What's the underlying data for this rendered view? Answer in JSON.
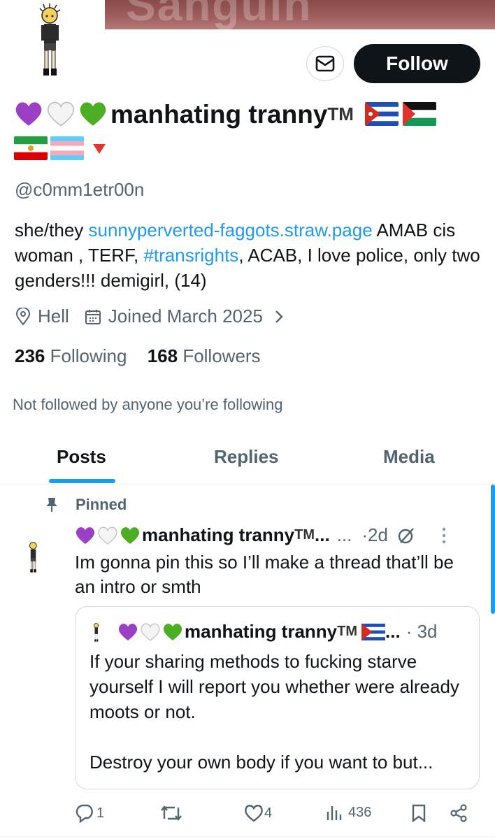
{
  "banner": {
    "partial_text": "Sanguin"
  },
  "header": {
    "follow_label": "Follow",
    "display_name": "manhating tranny",
    "name_tm": "TM",
    "handle": "@c0mm1etr00n",
    "flags": [
      "cuba-flag",
      "palestine-flag",
      "iran-lion-flag",
      "trans-flag",
      "red-triangle"
    ]
  },
  "bio": {
    "part1": "she/they ",
    "link": "sunnyperverted-faggots.straw.page",
    "part2": " AMAB cis woman , TERF, ",
    "hashtag": "#transrights",
    "part3": ", ACAB, I love police, only two genders!!! demigirl, (14)"
  },
  "meta": {
    "location": "Hell",
    "joined": "Joined March 2025"
  },
  "counts": {
    "following_count": "236",
    "following_label": "Following",
    "followers_count": "168",
    "followers_label": "Followers"
  },
  "not_followed_text": "Not followed by anyone you’re following",
  "tabs": [
    {
      "label": "Posts"
    },
    {
      "label": "Replies"
    },
    {
      "label": "Media"
    }
  ],
  "post": {
    "pinned_label": "Pinned",
    "name": "manhating tranny",
    "tm": "TM",
    "ellipsis": "...",
    "more": "...",
    "time": "·2d",
    "text": "Im gonna pin this so I’ll make a thread that’ll be an intro or smth",
    "quote": {
      "name": "manhating tranny",
      "tm": "TM",
      "ellipsis": "...",
      "time": "· 3d",
      "text_line1": "If your sharing methods to fucking starve yourself I will report you whether were already moots or not.",
      "text_line2": "Destroy your own body if you want to but..."
    },
    "actions": {
      "replies": "1",
      "reposts": "",
      "likes": "4",
      "views": "436"
    }
  },
  "colors": {
    "accent": "#1d9bf0",
    "text": "#0f1419",
    "muted": "#536471",
    "purple_heart": "#9b3fc4",
    "green_heart": "#4caf23"
  }
}
